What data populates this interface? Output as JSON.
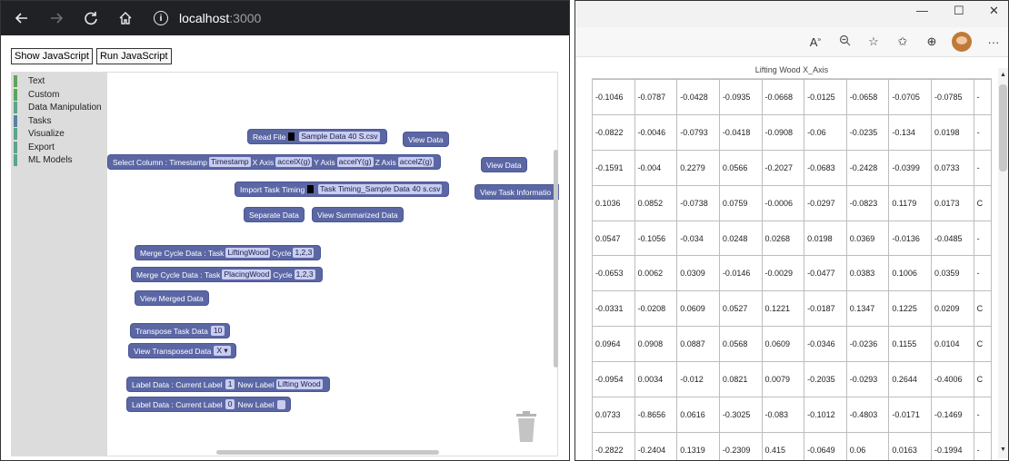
{
  "left_browser": {
    "url_host": "localhost",
    "url_port": ":3000",
    "buttons": {
      "show_js": "Show JavaScript",
      "run_js": "Run JavaScript"
    }
  },
  "categories": [
    "Text",
    "Custom",
    "Data Manipulation",
    "Tasks",
    "Visualize",
    "Export",
    "ML Models"
  ],
  "blocks": {
    "read_file": {
      "label": "Read File",
      "file": "Sample Data 40 S.csv"
    },
    "view_data_1": "View Data",
    "select_column": {
      "label": "Select Column : Timestamp",
      "timestamp": "Timestamp",
      "x_label": "X Axis",
      "x_val": "accelX(g)",
      "y_label": "Y Axis",
      "y_val": "accelY(g)",
      "z_label": "Z Axis",
      "z_val": "accelZ(g)"
    },
    "view_data_2": "View Data",
    "import_task": {
      "label": "Import Task Timing",
      "file": "Task Timing_Sample Data 40 s.csv"
    },
    "view_task_info": "View Task Informatio",
    "separate_data": "Separate Data",
    "view_summarized": "View Summarized Data",
    "merge1": {
      "label": "Merge Cycle Data : Task",
      "task": "LiftingWood",
      "cycle_label": "Cycle",
      "cycle": "1,2,3"
    },
    "merge2": {
      "label": "Merge Cycle Data : Task",
      "task": "PlacingWood",
      "cycle_label": "Cycle",
      "cycle": "1,2,3"
    },
    "view_merged": "View Merged Data",
    "transpose": {
      "label": "Transpose Task Data",
      "value": "10"
    },
    "view_transposed": {
      "label": "View Transposed Data",
      "value": "X"
    },
    "label1": {
      "label": "Label Data : Current Label",
      "current": "1",
      "new_label": "New Label",
      "new": "Lifting Wood"
    },
    "label2": {
      "label": "Label Data : Current Label",
      "current": "0",
      "new_label": "New Label"
    }
  },
  "right_table": {
    "title": "Lifting Wood X_Axis",
    "rows": [
      [
        "-0.1046",
        "-0.0787",
        "-0.0428",
        "-0.0935",
        "-0.0668",
        "-0.0125",
        "-0.0658",
        "-0.0705",
        "-0.0785",
        "-"
      ],
      [
        "-0.0822",
        "-0.0046",
        "-0.0793",
        "-0.0418",
        "-0.0908",
        "-0.06",
        "-0.0235",
        "-0.134",
        "0.0198",
        "-"
      ],
      [
        "-0.1591",
        "-0.004",
        "0.2279",
        "0.0566",
        "-0.2027",
        "-0.0683",
        "-0.2428",
        "-0.0399",
        "0.0733",
        "-"
      ],
      [
        "0.1036",
        "0.0852",
        "-0.0738",
        "0.0759",
        "-0.0006",
        "-0.0297",
        "-0.0823",
        "0.1179",
        "0.0173",
        "C"
      ],
      [
        "0.0547",
        "-0.1056",
        "-0.034",
        "0.0248",
        "0.0268",
        "0.0198",
        "0.0369",
        "-0.0136",
        "-0.0485",
        "-"
      ],
      [
        "-0.0653",
        "0.0062",
        "0.0309",
        "-0.0146",
        "-0.0029",
        "-0.0477",
        "0.0383",
        "0.1006",
        "0.0359",
        "-"
      ],
      [
        "-0.0331",
        "-0.0208",
        "0.0609",
        "0.0527",
        "0.1221",
        "-0.0187",
        "0.1347",
        "0.1225",
        "0.0209",
        "C"
      ],
      [
        "0.0964",
        "0.0908",
        "0.0887",
        "0.0568",
        "0.0609",
        "-0.0346",
        "-0.0236",
        "0.1155",
        "0.0104",
        "C"
      ],
      [
        "-0.0954",
        "0.0034",
        "-0.012",
        "0.0821",
        "0.0079",
        "-0.2035",
        "-0.0293",
        "0.2644",
        "-0.4006",
        "C"
      ],
      [
        "0.0733",
        "-0.8656",
        "0.0616",
        "-0.3025",
        "-0.083",
        "-0.1012",
        "-0.4803",
        "-0.0171",
        "-0.1469",
        "-"
      ],
      [
        "-0.2822",
        "-0.2404",
        "0.1319",
        "-0.2309",
        "0.415",
        "-0.0649",
        "0.06",
        "0.0163",
        "-0.1994",
        "-"
      ]
    ]
  }
}
